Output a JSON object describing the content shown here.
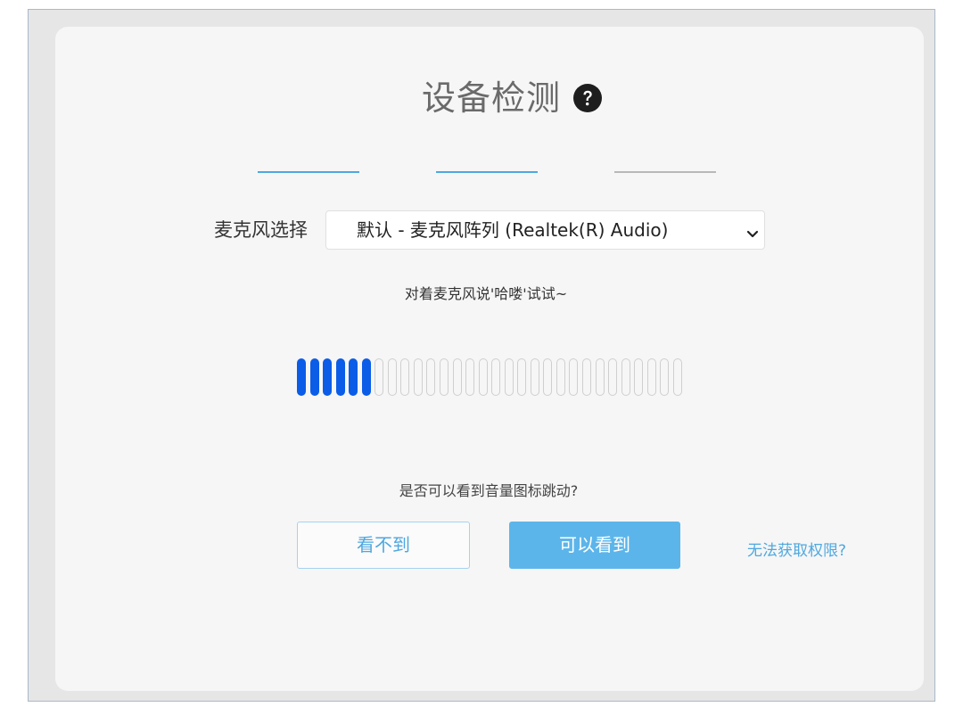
{
  "window": {
    "title": "设备检测",
    "help_icon": "help-circle-icon"
  },
  "steps": {
    "total": 3,
    "completed": 2
  },
  "microphone": {
    "label": "麦克风选择",
    "selected": "默认 - 麦克风阵列 (Realtek(R) Audio)",
    "dropdown_icon": "chevron-down-icon"
  },
  "hint": "对着麦克风说'哈喽'试试~",
  "meter": {
    "segments": 30,
    "lit": 6
  },
  "question": "是否可以看到音量图标跳动?",
  "buttons": {
    "cannot_see": "看不到",
    "can_see": "可以看到"
  },
  "permission_link": "无法获取权限?",
  "colors": {
    "accent": "#4ea8e0",
    "meter_active": "#0b5de8",
    "step_pending": "#b8b8b8",
    "primary_button": "#5cb5ea",
    "title": "#6a6a6a"
  }
}
